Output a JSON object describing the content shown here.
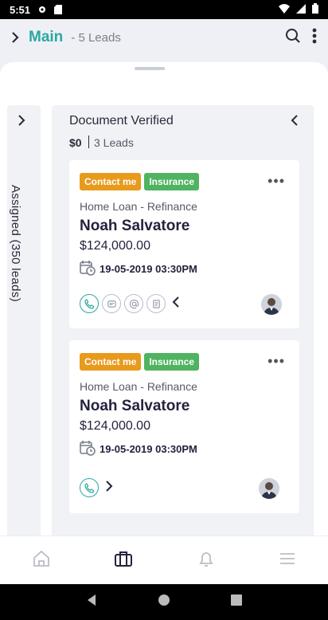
{
  "status": {
    "time": "5:51"
  },
  "header": {
    "title": "Main",
    "subtitle": "- 5 Leads"
  },
  "collapsed_column": {
    "label": "Assigned (350 leads)"
  },
  "column": {
    "title": "Document Verified",
    "amount": "$0",
    "count": "3 Leads"
  },
  "cards": [
    {
      "tags": [
        "Contact me",
        "Insurance"
      ],
      "loan_type": "Home Loan - Refinance",
      "name": "Noah Salvatore",
      "amount": "$124,000.00",
      "date": "19-05-2019 03:30PM"
    },
    {
      "tags": [
        "Contact me",
        "Insurance"
      ],
      "loan_type": "Home Loan - Refinance",
      "name": "Noah Salvatore",
      "amount": "$124,000.00",
      "date": "19-05-2019 03:30PM"
    }
  ],
  "colors": {
    "accent": "#2ba7a1",
    "tag_orange": "#e89a1c",
    "tag_green": "#4fb360"
  }
}
